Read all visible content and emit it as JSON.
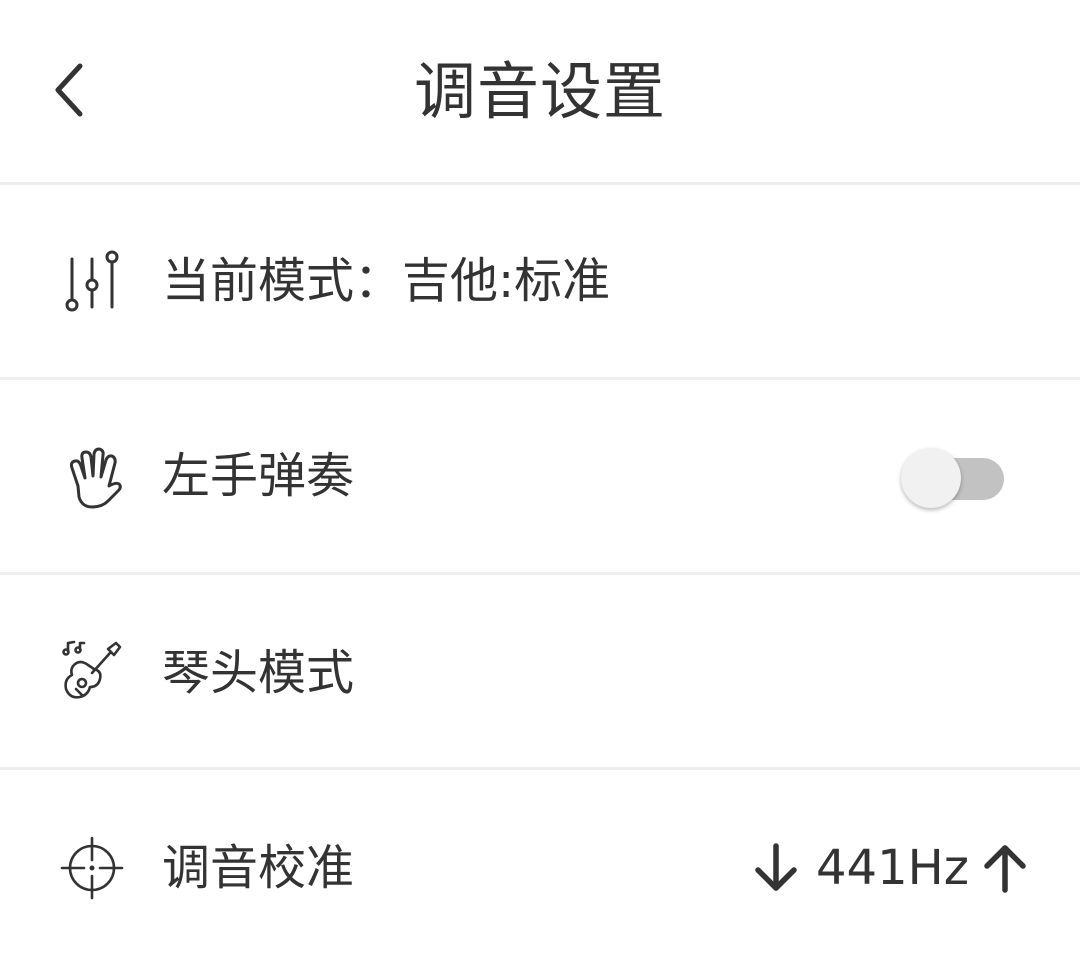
{
  "header": {
    "title": "调音设置",
    "back_icon": "chevron-left-icon"
  },
  "settings": {
    "current_mode": {
      "label": "当前模式：吉他:标准",
      "icon": "sliders-icon"
    },
    "left_hand": {
      "label": "左手弹奏",
      "icon": "hand-icon",
      "enabled": false
    },
    "headstock_mode": {
      "label": "琴头模式",
      "icon": "guitar-icon"
    },
    "calibration": {
      "label": "调音校准",
      "icon": "crosshair-icon",
      "value": "441Hz",
      "decrease_icon": "arrow-down-icon",
      "increase_icon": "arrow-up-icon"
    }
  },
  "colors": {
    "text": "#333333",
    "divider": "#eeeeee",
    "toggle_track_off": "#c2c2c2",
    "toggle_knob": "#f1f1f1"
  }
}
